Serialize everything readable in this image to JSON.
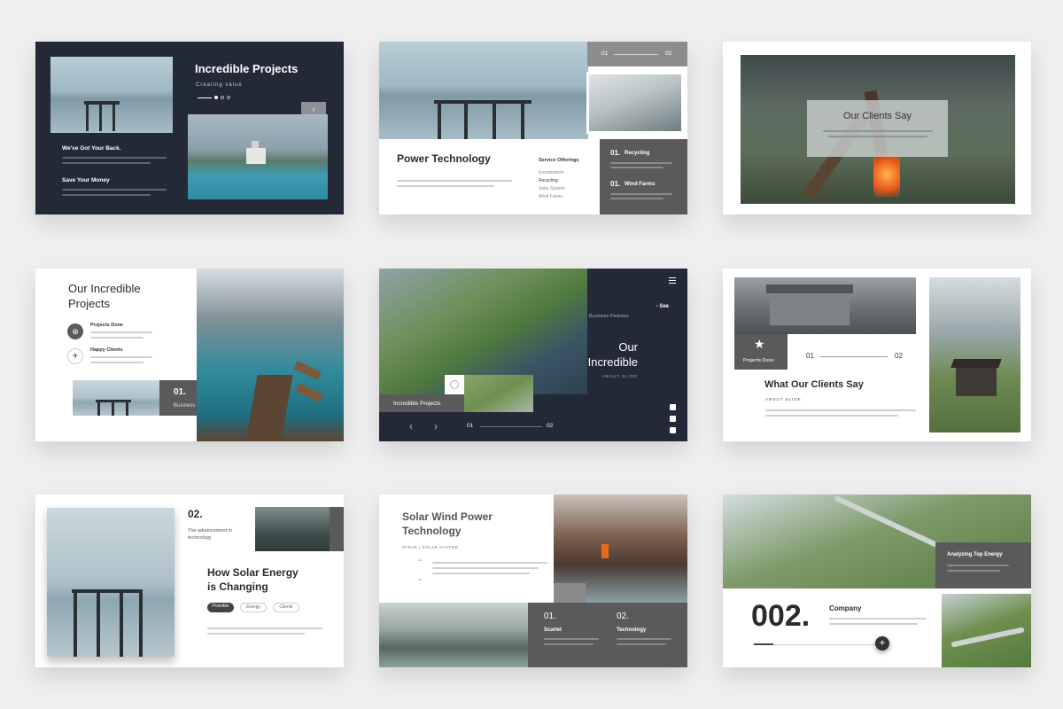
{
  "slide1": {
    "title": "Incredible Projects",
    "subtitle": "Creating value",
    "h1": "We've Got Your Back.",
    "h2": "Save Your Money"
  },
  "slide2": {
    "num_a": "01",
    "num_b": "02",
    "title": "Power Technology",
    "menu_title": "Service Offerings",
    "menu": [
      "Environment",
      "Recycling",
      "Solar System",
      "Wind Farms"
    ],
    "box1_num": "01.",
    "box1_label": "Recycling",
    "box2_num": "01.",
    "box2_label": "Wind Farms"
  },
  "slide3": {
    "title": "Our Clients Say"
  },
  "slide4": {
    "title1": "Our Incredible",
    "title2": "Projects",
    "item1": "Projects Done",
    "item2": "Happy Clients",
    "num": "01.",
    "label": "Business Partners"
  },
  "slide5": {
    "see": "- See",
    "partners": "Business Partners",
    "title1": "Our",
    "title2": "Incredible",
    "about": "ABOUT SLIDE",
    "cta": "Incredible Projects",
    "num_a": "01",
    "num_b": "02"
  },
  "slide6": {
    "badge": "Projects Done",
    "num_a": "01",
    "num_b": "02",
    "title": "What Our Clients Say",
    "about": "ABOUT SLIDE"
  },
  "slide7": {
    "num": "02.",
    "sub1": "The advancement in",
    "sub2": "technology",
    "title1": "How Solar Energy",
    "title2": "is Changing",
    "tag1": "Possible",
    "tag2": "Energy",
    "tag3": "Clients"
  },
  "slide8": {
    "title1": "Solar Wind Power",
    "title2": "Technology",
    "byline": "STEVE | SOLAR SYSTEM",
    "num1": "01.",
    "label1": "Scarlet",
    "num2": "02.",
    "label2": "Technology"
  },
  "slide9": {
    "box_title": "Analyzing Top Energy",
    "big_num": "002.",
    "company": "Company"
  },
  "colors": {
    "dark": "#232936",
    "grey": "#5a5a5a",
    "accent_grey": "#8a8a8a"
  }
}
